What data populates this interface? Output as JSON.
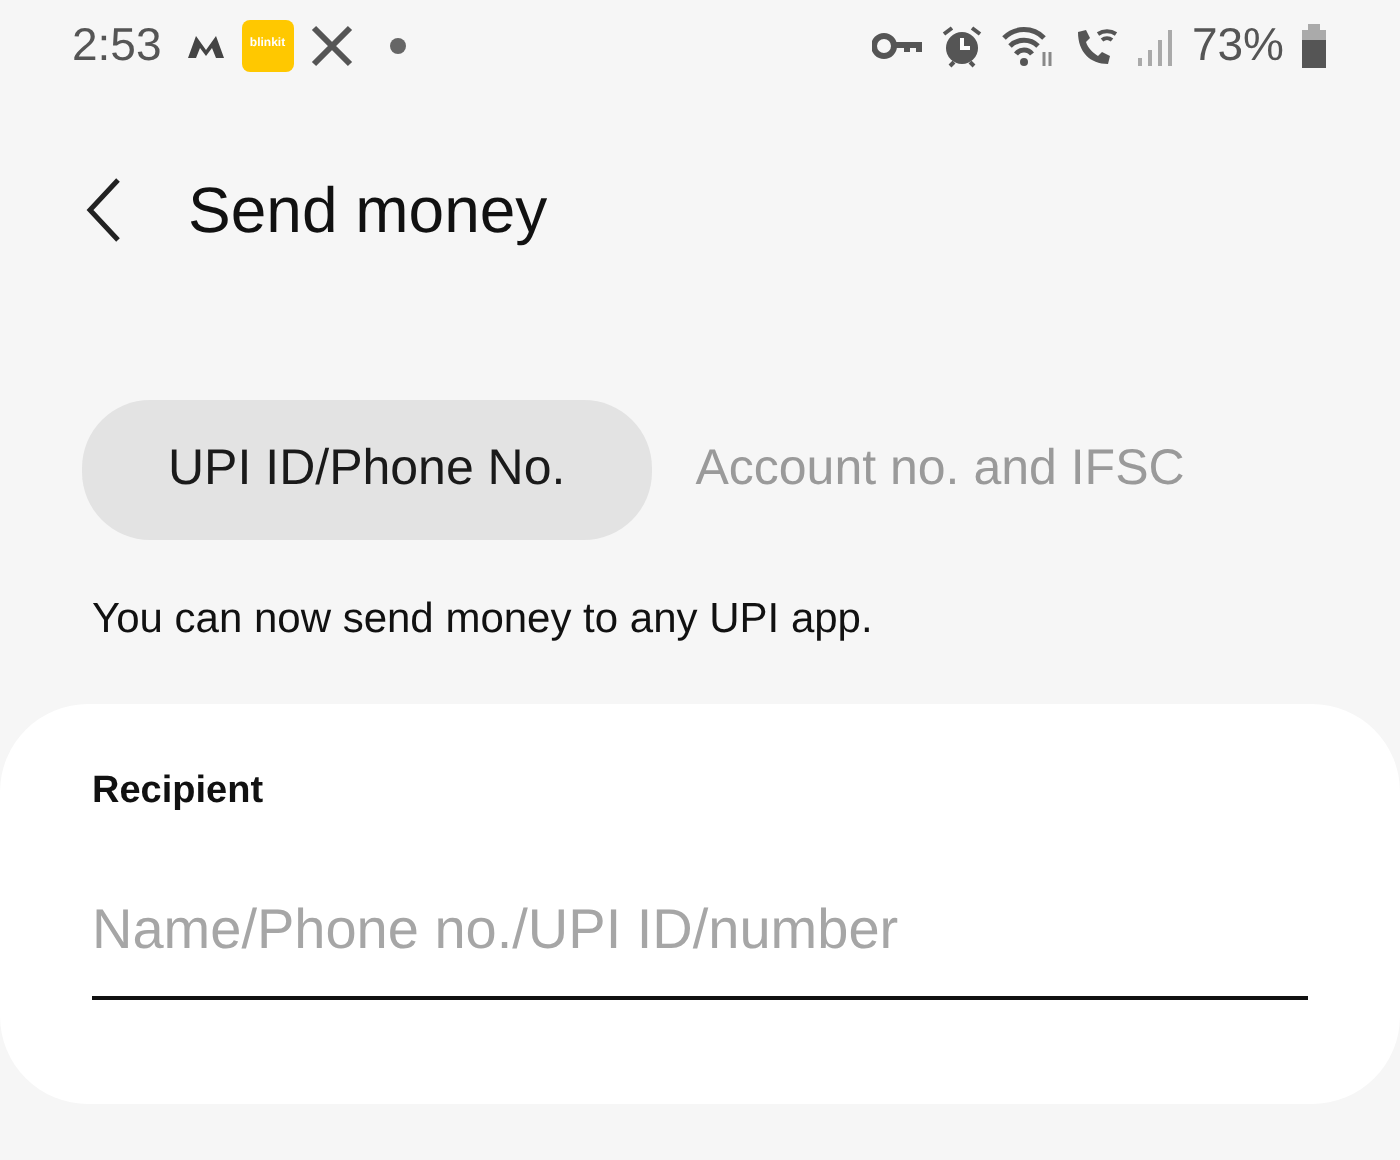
{
  "status_bar": {
    "time": "2:53",
    "notification_apps": [
      {
        "kind": "m"
      },
      {
        "kind": "badge",
        "label": "blinkit"
      },
      {
        "kind": "x"
      },
      {
        "kind": "dot"
      }
    ],
    "battery": "73%"
  },
  "header": {
    "title": "Send money"
  },
  "tabs": [
    {
      "label": "UPI ID/Phone No.",
      "selected": true
    },
    {
      "label": "Account no. and IFSC",
      "selected": false
    }
  ],
  "info": "You can now send money to any UPI app.",
  "recipient": {
    "label": "Recipient",
    "placeholder": "Name/Phone no./UPI ID/number"
  }
}
